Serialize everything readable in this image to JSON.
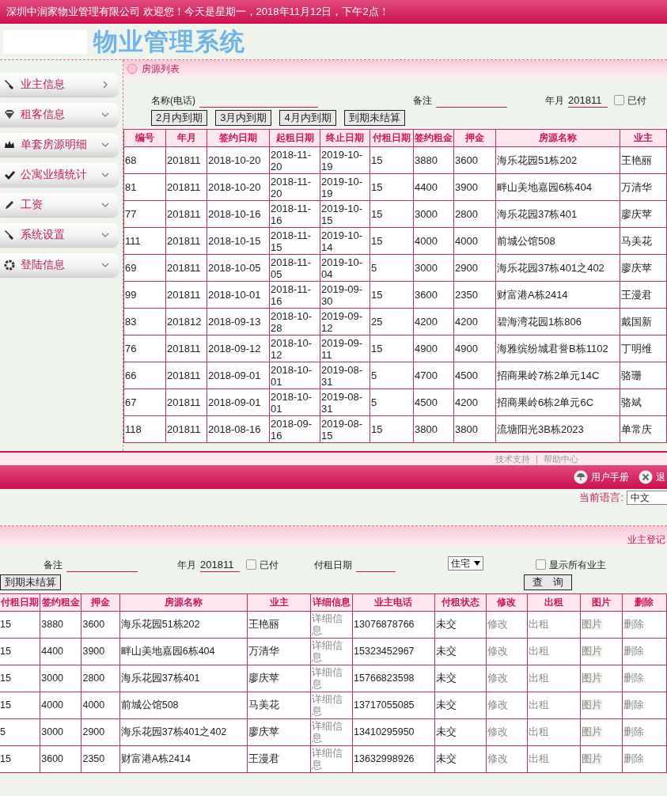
{
  "top": {
    "header_text": "深圳中润家物业管理有限公司 欢迎您！今天是星期一，2018年11月12日，下午2点！",
    "logo": "物业管理系统",
    "sidebar": {
      "items": [
        {
          "label": "业主信息",
          "expanded": false
        },
        {
          "label": "租客信息",
          "expanded": true
        },
        {
          "label": "单套房源明细",
          "expanded": true
        },
        {
          "label": "公寓业绩统计",
          "expanded": true
        },
        {
          "label": "工资",
          "expanded": true
        },
        {
          "label": "系统设置",
          "expanded": true
        },
        {
          "label": "登陆信息",
          "expanded": true
        }
      ]
    },
    "panel_title": "房源列表",
    "filters": {
      "name_label": "名称(电话)",
      "remark_label": "备注",
      "month_label": "年月",
      "month_value": "201811",
      "paid": {
        "label": "已付",
        "checked": false
      }
    },
    "buttons": [
      "2月内到期",
      "3月内到期",
      "4月内到期",
      "到期未结算"
    ],
    "table": {
      "columns": [
        "编号",
        "年月",
        "签约日期",
        "起租日期",
        "终止日期",
        "付租日期",
        "签约租金",
        "押金",
        "房源名称",
        "业主"
      ],
      "rows": [
        [
          "68",
          "201811",
          "2018-10-20",
          "2018-11-20",
          "2019-10-19",
          "15",
          "3880",
          "3600",
          "海乐花园51栋202",
          "王艳丽"
        ],
        [
          "81",
          "201811",
          "2018-10-20",
          "2018-11-20",
          "2019-10-19",
          "15",
          "4400",
          "3900",
          "畔山美地嘉园6栋404",
          "万清华"
        ],
        [
          "77",
          "201811",
          "2018-10-16",
          "2018-11-16",
          "2019-10-15",
          "15",
          "3000",
          "2800",
          "海乐花园37栋401",
          "廖庆苹"
        ],
        [
          "111",
          "201811",
          "2018-10-15",
          "2018-11-15",
          "2019-10-14",
          "15",
          "4000",
          "4000",
          "前城公馆508",
          "马美花"
        ],
        [
          "69",
          "201811",
          "2018-10-05",
          "2018-11-05",
          "2019-10-04",
          "5",
          "3000",
          "2900",
          "海乐花园37栋401之402",
          "廖庆苹"
        ],
        [
          "99",
          "201811",
          "2018-10-01",
          "2018-11-16",
          "2019-09-30",
          "15",
          "3600",
          "2350",
          "财富港A栋2414",
          "王漫君"
        ],
        [
          "83",
          "201812",
          "2018-09-13",
          "2018-10-28",
          "2019-09-12",
          "25",
          "4200",
          "4200",
          "碧海湾花园1栋806",
          "戴国新"
        ],
        [
          "76",
          "201811",
          "2018-09-12",
          "2018-10-12",
          "2019-09-11",
          "15",
          "4900",
          "4900",
          "海雅缤纷城君誉B栋1102",
          "丁明维"
        ],
        [
          "66",
          "201811",
          "2018-09-01",
          "2018-10-01",
          "2019-08-31",
          "5",
          "4700",
          "4500",
          "招商果岭7栋2单元14C",
          "骆珊"
        ],
        [
          "67",
          "201811",
          "2018-09-01",
          "2018-10-01",
          "2019-08-31",
          "5",
          "4500",
          "4200",
          "招商果岭6栋2单元6C",
          "骆斌"
        ],
        [
          "118",
          "201811",
          "2018-08-16",
          "2018-09-16",
          "2019-08-15",
          "15",
          "3800",
          "3800",
          "流塘阳光3B栋2023",
          "单常庆"
        ]
      ]
    },
    "footer_links": [
      "技术支持",
      "帮助中心"
    ]
  },
  "bottom": {
    "toolbar": [
      {
        "label": "用户手册",
        "kind": "manual"
      },
      {
        "label": "退",
        "kind": "exit"
      }
    ],
    "language_label": "当前语言:",
    "language_value": "中文",
    "panel_link": "业主登记",
    "filters": {
      "remark_label": "备注",
      "month_label": "年月",
      "month_value": "201811",
      "paid": {
        "label": "已付",
        "checked": false
      },
      "rent_date_label": "付租日期",
      "type_value": "住宅",
      "show_all": {
        "label": "显示所有业主",
        "checked": false
      }
    },
    "buttons": [
      "到期未结算",
      "查　询"
    ],
    "table": {
      "columns": [
        {
          "label": "付租日期",
          "kind": "text"
        },
        {
          "label": "签约租金",
          "kind": "text"
        },
        {
          "label": "押金",
          "kind": "text"
        },
        {
          "label": "房源名称",
          "kind": "text"
        },
        {
          "label": "业主",
          "kind": "text"
        },
        {
          "label": "详细信息",
          "kind": "link"
        },
        {
          "label": "业主电话",
          "kind": "text"
        },
        {
          "label": "付租状态",
          "kind": "text"
        },
        {
          "label": "修改",
          "kind": "link"
        },
        {
          "label": "出租",
          "kind": "link"
        },
        {
          "label": "图片",
          "kind": "tag"
        },
        {
          "label": "删除",
          "kind": "link"
        }
      ],
      "rows": [
        [
          "15",
          "3880",
          "3600",
          "海乐花园51栋202",
          "王艳丽",
          "详细信息",
          "13076878766",
          "未交",
          "修改",
          "出租",
          "图片",
          "删除"
        ],
        [
          "15",
          "4400",
          "3900",
          "畔山美地嘉园6栋404",
          "万清华",
          "详细信息",
          "15323452967",
          "未交",
          "修改",
          "出租",
          "图片",
          "删除"
        ],
        [
          "15",
          "3000",
          "2800",
          "海乐花园37栋401",
          "廖庆苹",
          "详细信息",
          "15766823598",
          "未交",
          "修改",
          "出租",
          "图片",
          "删除"
        ],
        [
          "15",
          "4000",
          "4000",
          "前城公馆508",
          "马美花",
          "详细信息",
          "13717055085",
          "未交",
          "修改",
          "出租",
          "图片",
          "删除"
        ],
        [
          "5",
          "3000",
          "2900",
          "海乐花园37栋401之402",
          "廖庆苹",
          "详细信息",
          "13410295950",
          "未交",
          "修改",
          "出租",
          "图片",
          "删除"
        ],
        [
          "15",
          "3600",
          "2350",
          "财富港A栋2414",
          "王漫君",
          "详细信息",
          "13632998926",
          "未交",
          "修改",
          "出租",
          "图片",
          "删除"
        ]
      ]
    }
  }
}
